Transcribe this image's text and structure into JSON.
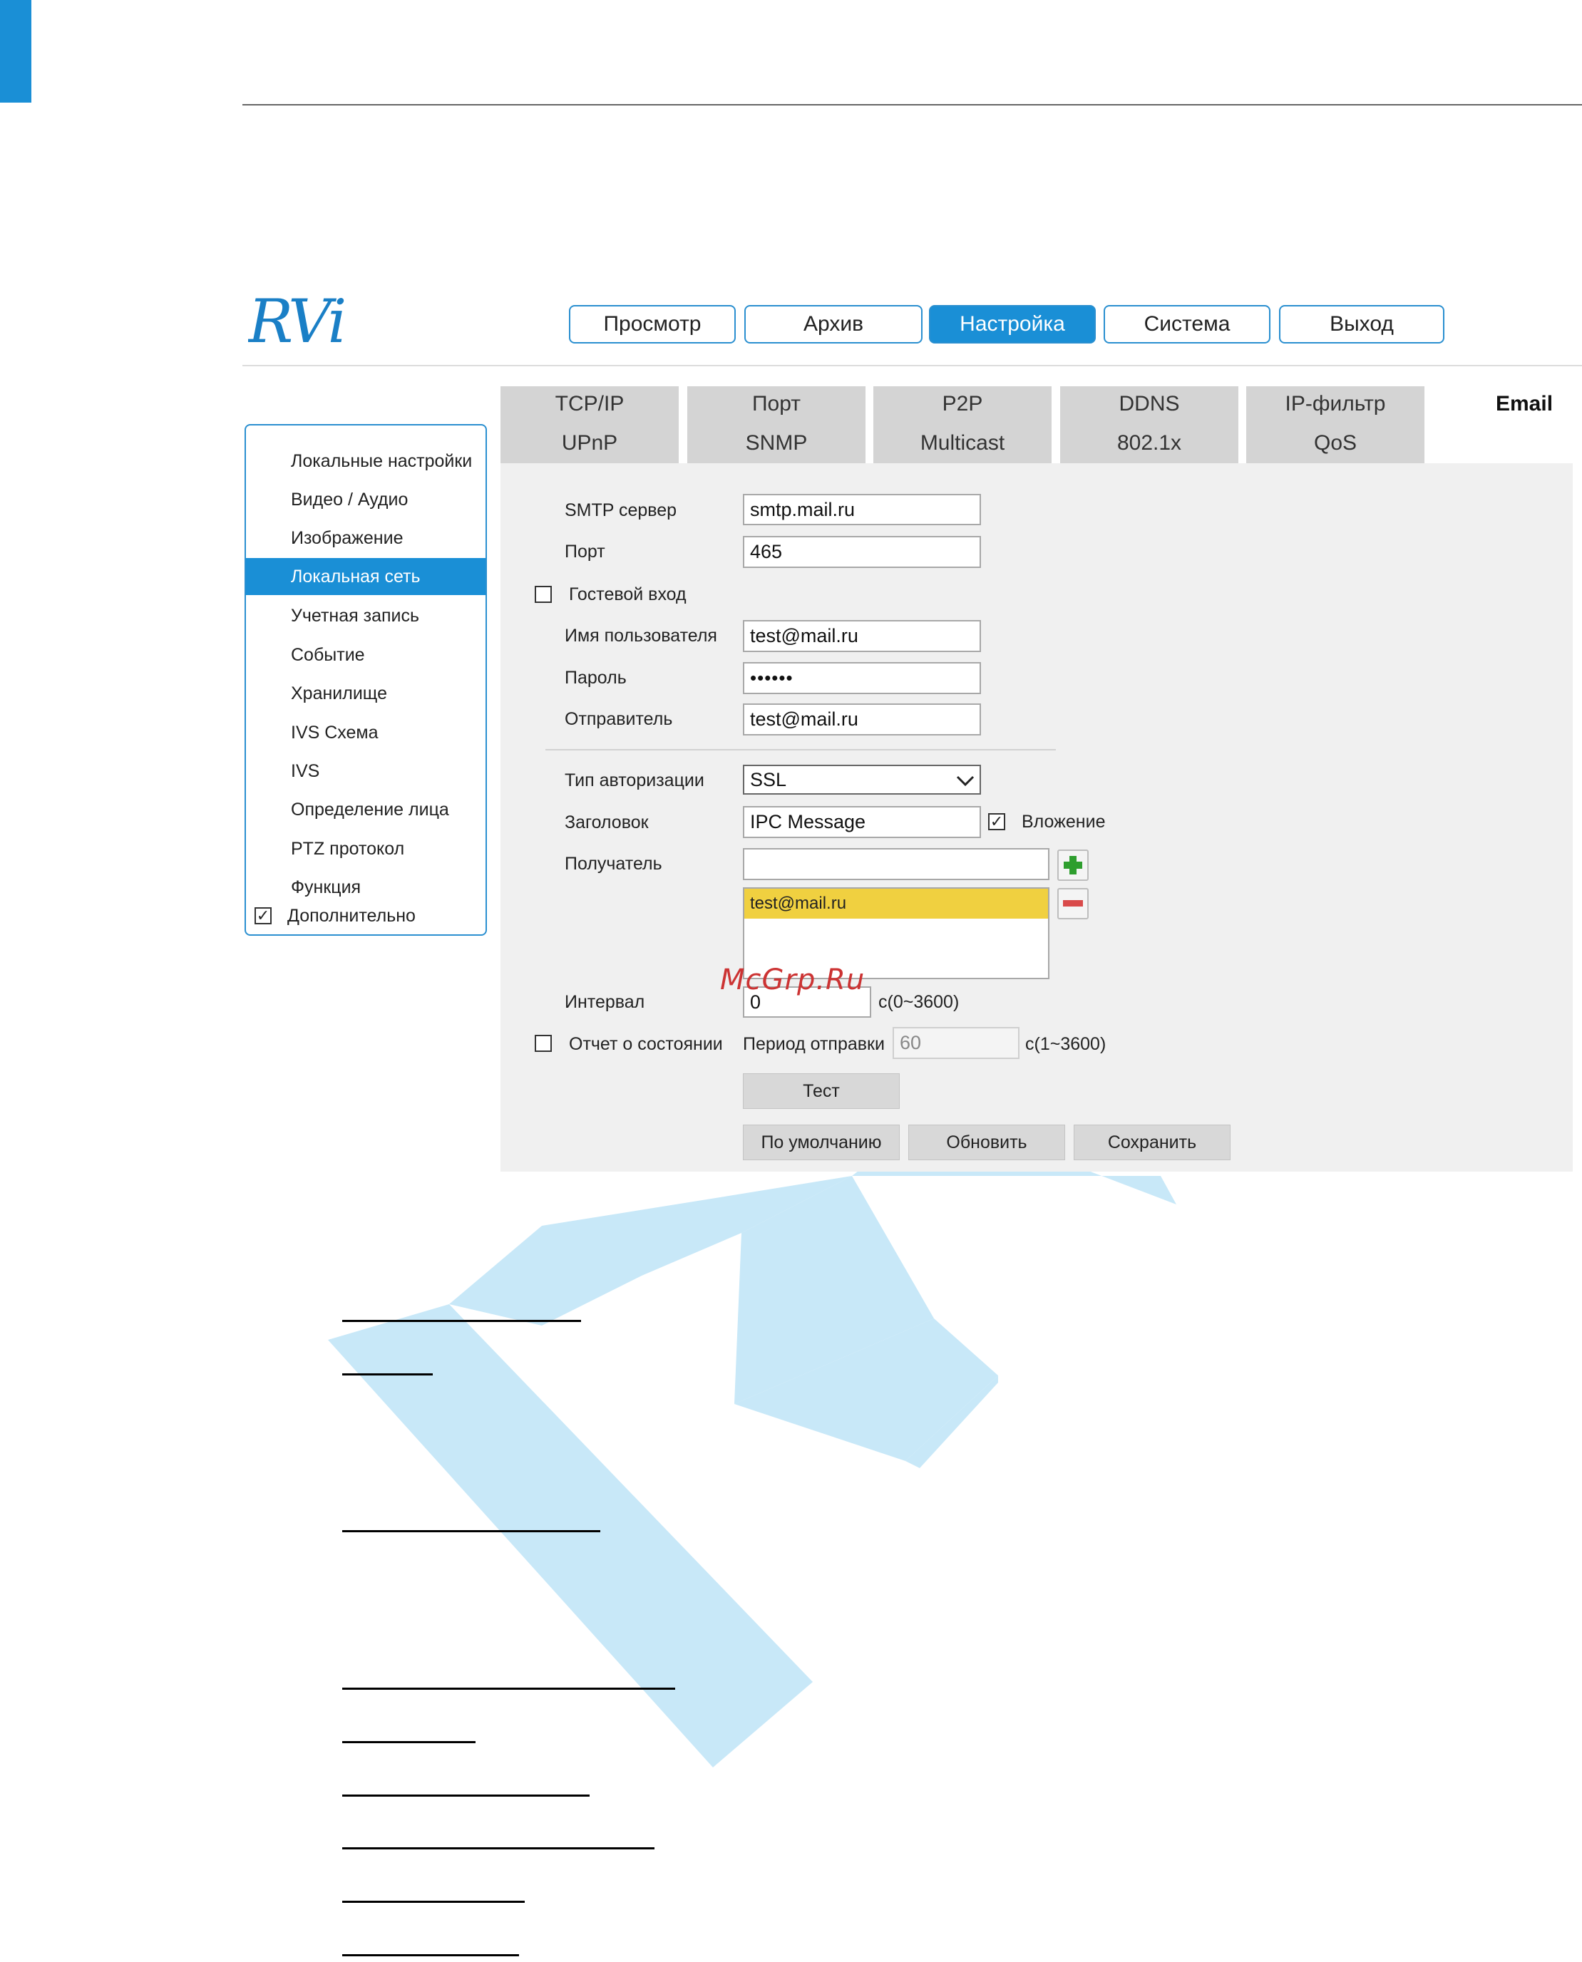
{
  "logo_text": "RVi",
  "nav": {
    "items": [
      "Просмотр",
      "Архив",
      "Настройка",
      "Система",
      "Выход"
    ],
    "active_index": 2
  },
  "sidebar": {
    "items": [
      "Локальные настройки",
      "Видео / Аудио",
      "Изображение",
      "Локальная сеть",
      "Учетная запись",
      "Событие",
      "Хранилище",
      "IVS Схема",
      "IVS",
      "Определение лица",
      "PTZ протокол",
      "Функция"
    ],
    "active_index": 3,
    "advanced_label": "Дополнительно",
    "advanced_checked": true
  },
  "tabs": {
    "row1": [
      "TCP/IP",
      "Порт",
      "P2P",
      "DDNS",
      "IP-фильтр"
    ],
    "row2": [
      "UPnP",
      "SNMP",
      "Multicast",
      "802.1x",
      "QoS"
    ],
    "active": "Email"
  },
  "form": {
    "smtp_label": "SMTP сервер",
    "smtp_value": "smtp.mail.ru",
    "port_label": "Порт",
    "port_value": "465",
    "guest_label": "Гостевой вход",
    "guest_checked": false,
    "user_label": "Имя пользователя",
    "user_value": "test@mail.ru",
    "password_label": "Пароль",
    "password_value": "••••••",
    "sender_label": "Отправитель",
    "sender_value": "test@mail.ru",
    "auth_label": "Тип авторизации",
    "auth_value": "SSL",
    "subject_label": "Заголовок",
    "subject_value": "IPC Message",
    "attachment_label": "Вложение",
    "attachment_checked": true,
    "recipient_label": "Получатель",
    "recipient_value": "",
    "recipients": [
      "test@mail.ru"
    ],
    "interval_label": "Интервал",
    "interval_value": "0",
    "interval_unit": "с(0~3600)",
    "status_label": "Отчет о состоянии",
    "status_checked": false,
    "period_label": "Период отправки",
    "period_value": "60",
    "period_unit": "с(1~3600)"
  },
  "buttons": {
    "test": "Тест",
    "default": "По умолчанию",
    "refresh": "Обновить",
    "save": "Сохранить"
  },
  "watermark_text": "McGrp.Ru",
  "colors": {
    "accent": "#1a8fd6",
    "selected_row": "#f0d040",
    "add_icon": "#2e9e2e",
    "remove_icon": "#d94a4a",
    "watermark_r": "#c8e8f8"
  }
}
